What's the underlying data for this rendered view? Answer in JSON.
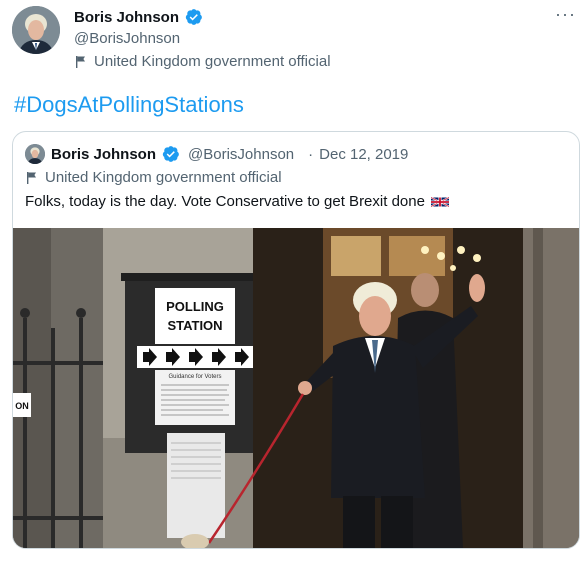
{
  "tweet": {
    "author_name": "Boris Johnson",
    "author_handle": "@BorisJohnson",
    "government_label": "United Kingdom government official",
    "more_icon": "more-icon",
    "hashtag": "#DogsAtPollingStations"
  },
  "quoted": {
    "author_name": "Boris Johnson",
    "author_handle": "@BorisJohnson",
    "separator": "·",
    "date": "Dec 12, 2019",
    "government_label": "United Kingdom government official",
    "text": "Folks, today is the day. Vote Conservative to get Brexit done",
    "emoji_icon": "uk-flag-icon"
  },
  "photo": {
    "sign_line1": "POLLING",
    "sign_line2": "STATION",
    "notice_title": "Guidance for Voters",
    "door_sign": "ON"
  },
  "colors": {
    "accent": "#1d9bf0",
    "secondary_text": "#536471",
    "border": "#cfd9de"
  }
}
